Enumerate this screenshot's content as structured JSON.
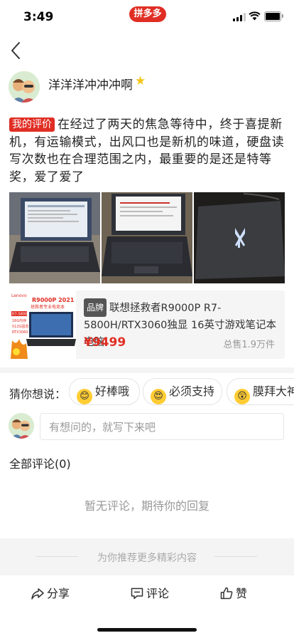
{
  "status": {
    "time": "3:49",
    "app_badge": "拼多多"
  },
  "author": {
    "name": "洋洋洋冲冲冲啊"
  },
  "review": {
    "tag": "我的评价",
    "text": "在经过了两天的焦急等待中，终于喜提新机，有运输模式，出风口也是新机的味道，硬盘读写次数也在合理范围之内，最重要的是还是特等奖，爱了爱了"
  },
  "product": {
    "thumb_brand": "Lenovo",
    "thumb_title": "R9000P 2021",
    "thumb_sub": "拯救者专业电竞本",
    "thumb_specs": [
      "R7-5800H",
      "16G内存",
      "512G固态",
      "RTX3060"
    ],
    "brand_tag": "品牌",
    "title": "联想拯救者R9000P R7-5800H/RTX3060独显 16英寸游戏笔记本电脑",
    "price": "¥9499",
    "sold": "总售1.9万件"
  },
  "guess": {
    "label": "猜你想说：",
    "chips": [
      {
        "emoji": "😊",
        "label": "好棒哦"
      },
      {
        "emoji": "😍",
        "label": "必须支持"
      },
      {
        "emoji": "😲",
        "label": "膜拜大神"
      }
    ]
  },
  "comment_input": {
    "placeholder": "有想问的，就写下来吧"
  },
  "comments": {
    "header": "全部评论(0)",
    "empty": "暂无评论，期待你的回复"
  },
  "recommend": {
    "text": "为你推荐更多精彩内容"
  },
  "bottom_bar": {
    "share": "分享",
    "comment": "评论",
    "like": "赞"
  },
  "colors": {
    "accent": "#e02e24",
    "text": "#222222",
    "muted": "#999999"
  }
}
